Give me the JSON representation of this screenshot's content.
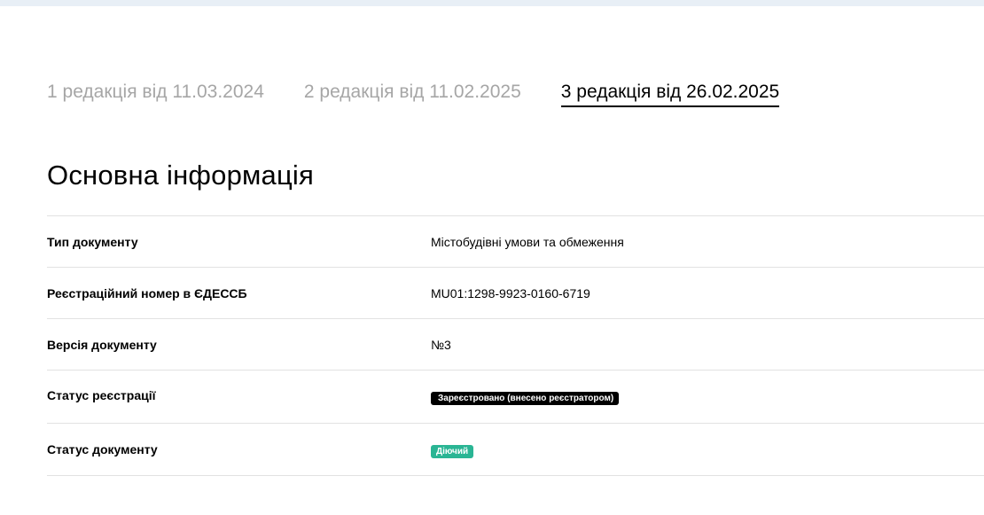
{
  "tabs": [
    {
      "label": "1 редакція від 11.03.2024",
      "active": false
    },
    {
      "label": "2 редакція від 11.02.2025",
      "active": false
    },
    {
      "label": "3 редакція від 26.02.2025",
      "active": true
    }
  ],
  "section": {
    "title": "Основна інформація"
  },
  "rows": [
    {
      "label": "Тип документу",
      "value": "Містобудівні умови та обмеження"
    },
    {
      "label": "Реєстраційний номер в ЄДЕССБ",
      "value": "MU01:1298-9923-0160-6719"
    },
    {
      "label": "Версія документу",
      "value": "№3"
    },
    {
      "label": "Статус реєстрації",
      "value": "Зареєстровано (внесено реєстратором)"
    },
    {
      "label": "Статус документу",
      "value": "Діючий"
    }
  ],
  "colors": {
    "registration_badge": "#000000",
    "status_badge": "#2ab594",
    "inactive_tab": "#a6a6a6",
    "top_strip": "#e8eff6"
  }
}
